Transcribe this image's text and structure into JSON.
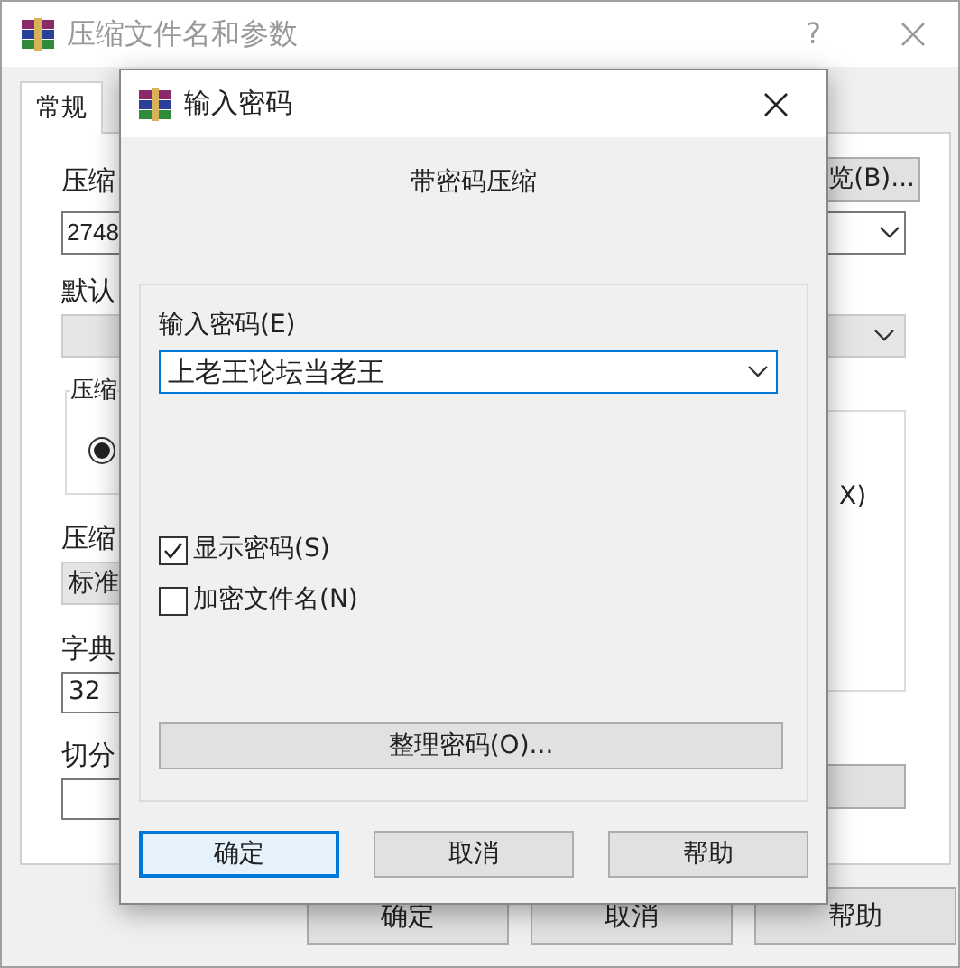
{
  "main_window": {
    "title": "压缩文件名和参数",
    "help_button": "?",
    "tabs": [
      {
        "label": "常规",
        "selected": true
      }
    ],
    "archive_name": {
      "label": "压缩",
      "value": "2748"
    },
    "browse_button": "览(B)...",
    "default_profile": {
      "label": "默认"
    },
    "format_group": {
      "label": "压缩",
      "radio_selected": true
    },
    "options_fragment": "X)",
    "method": {
      "label": "压缩",
      "value": "标准"
    },
    "dictionary": {
      "label": "字典",
      "value": "32"
    },
    "split": {
      "label": "切分"
    },
    "buttons": [
      "确定",
      "取消",
      "帮助"
    ]
  },
  "password_dialog": {
    "title": "输入密码",
    "heading": "带密码压缩",
    "password_label": "输入密码(E)",
    "password_value": "上老王论坛当老王",
    "options": [
      {
        "label": "显示密码(S)",
        "checked": true
      },
      {
        "label": "加密文件名(N)",
        "checked": false
      }
    ],
    "organize_button": "整理密码(O)...",
    "buttons": [
      {
        "label": "确定",
        "default": true
      },
      {
        "label": "取消",
        "default": false
      },
      {
        "label": "帮助",
        "default": false
      }
    ]
  }
}
